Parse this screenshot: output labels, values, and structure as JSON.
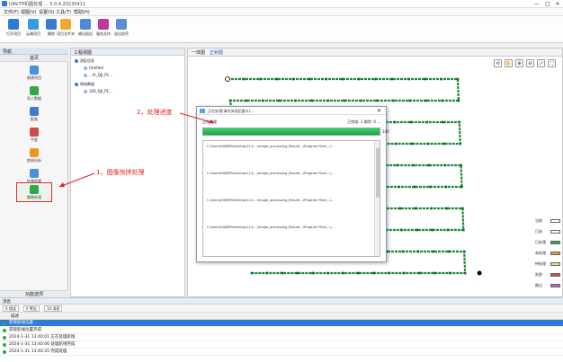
{
  "window": {
    "title": "UAV-TP机图处理 ... 5.0.4.20230411",
    "minimize": "—",
    "maximize": "□",
    "close": "✕"
  },
  "menu": [
    "文件(F)",
    "视图(V)",
    "设置(S)",
    "工具(T)",
    "帮助(H)"
  ],
  "toolbar": [
    {
      "label": "打开项目",
      "icon": "open-project-icon",
      "color": "#2e7bd6"
    },
    {
      "label": "云端项目",
      "icon": "cloud-project-icon",
      "color": "#3a9be0"
    },
    {
      "label": "删除",
      "icon": "delete-icon",
      "color": "#3a7bd0"
    },
    {
      "label": "项目文件夹",
      "icon": "folder-icon",
      "color": "#f0a830"
    },
    {
      "label": "输出报告",
      "icon": "report-icon",
      "color": "#4b8ad8"
    },
    {
      "label": "服务支持",
      "icon": "support-icon",
      "color": "#c0389c"
    },
    {
      "label": "退出程序",
      "icon": "exit-icon",
      "color": "#5a8fd0"
    }
  ],
  "sidebar": {
    "panel_title": "导航",
    "section": "首页",
    "footer": "功能选项",
    "items": [
      {
        "label": "新建项目",
        "icon": "new-project-icon",
        "color": "#4a90e0"
      },
      {
        "label": "导入数据",
        "icon": "import-data-icon",
        "color": "#2ea84a"
      },
      {
        "label": "配准",
        "icon": "register-icon",
        "color": "#3a7bd0"
      },
      {
        "label": "平差",
        "icon": "adjust-icon",
        "color": "#d04a4a"
      },
      {
        "label": "航线分析",
        "icon": "route-analysis-icon",
        "color": "#e89a20"
      },
      {
        "label": "检查结果",
        "icon": "check-result-icon",
        "color": "#4a90e0"
      },
      {
        "label": "图像处理",
        "icon": "image-process-icon",
        "color": "#2ea84a"
      }
    ]
  },
  "tree": {
    "panel_title": "工程视图",
    "nodes": [
      {
        "label": "测区信息",
        "indent": 0
      },
      {
        "label": "Untitled",
        "indent": 1
      },
      {
        "label": "...中_DJI_P1...",
        "indent": 1
      },
      {
        "label": "原始数据",
        "indent": 0
      },
      {
        "label": "100_DJI_P1...",
        "indent": 1
      }
    ]
  },
  "map": {
    "tabs": [
      "一体图",
      "正射图"
    ],
    "tools": [
      "⟲",
      "✋",
      "⊕",
      "⊖",
      "⤢",
      "⛶"
    ],
    "legend": [
      {
        "label": "当前",
        "color": "#ffffff"
      },
      {
        "label": "已选",
        "color": "#ffffff"
      },
      {
        "label": "已处理",
        "color": "#2ea84a"
      },
      {
        "label": "未处理",
        "color": "#e8a030"
      },
      {
        "label": "待处理",
        "color": "#f2d880"
      },
      {
        "label": "失败",
        "color": "#e84040"
      },
      {
        "label": "跳过",
        "color": "#c060c0"
      }
    ]
  },
  "dialog": {
    "title": "正在处理(请勿关闭此窗口)...",
    "close": "✕",
    "phase": "正在处理",
    "status": "已完成: 1 剩余: 0 ...",
    "progress_pct": 100,
    "progress_label": "100",
    "log_lines": [
      "C:\\Users\\HZJBP\\Desktop\\111\\...\\image_processing_Result\\...\\Program Files\\...\\...",
      "C:\\Users\\HZJBP\\Desktop\\111\\...\\image_processing_Result\\...\\Program Files\\...\\...",
      "C:\\Users\\HZJBP\\Desktop\\111\\...\\image_processing_Result\\...\\Program Files\\...\\...",
      "C:\\Users\\HZJBP\\Desktop\\111\\...\\image_processing_Result\\...\\Program Files\\...\\..."
    ]
  },
  "annotations": {
    "image_process": "1，图像快拼处理",
    "progress": "2，处理进度"
  },
  "log": {
    "panel_title": "消息",
    "filters": [
      "0 错误",
      "0 警告",
      "14 消息"
    ],
    "column": "描述",
    "rows": [
      {
        "text": "获取航线位置...",
        "selected": true
      },
      {
        "text": "获取航线位置完成",
        "selected": false
      },
      {
        "text": "2024-1-31 13:40:01   正在处理航线",
        "selected": false
      },
      {
        "text": "2024-1-31 13:40:06   处理航线完成",
        "selected": false
      },
      {
        "text": "2024-1-31 13:40:25   完成处理",
        "selected": false
      }
    ]
  },
  "flight_grid": {
    "title": "",
    "rows": 10,
    "columns": 15
  }
}
